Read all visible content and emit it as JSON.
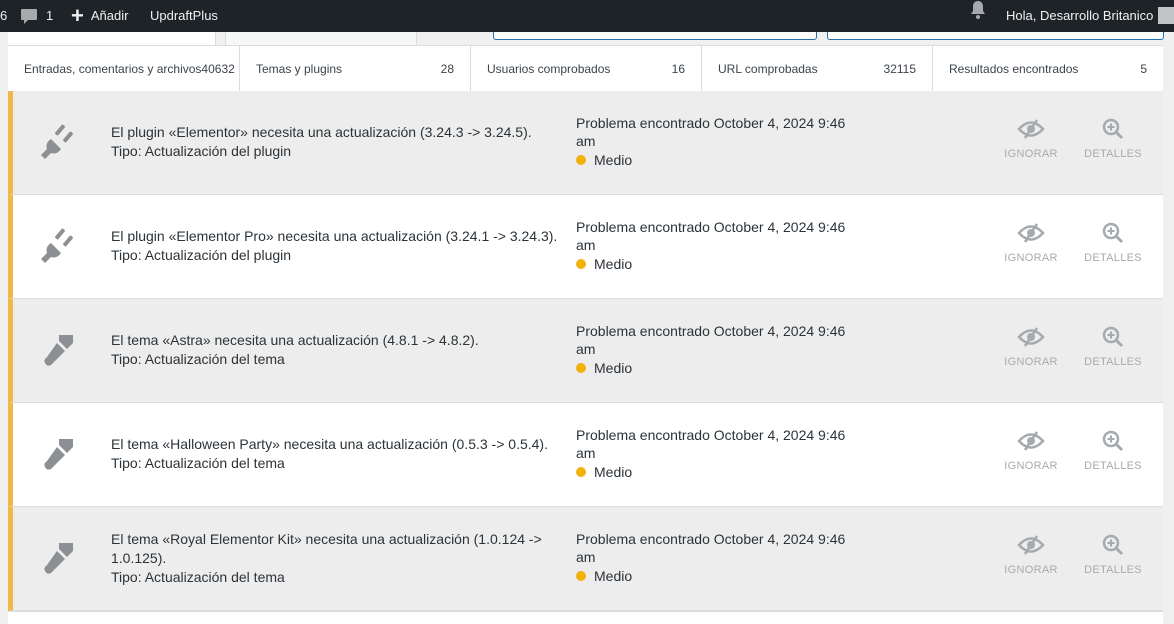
{
  "admin_bar": {
    "updates_count": "6",
    "comments_count": "1",
    "new_label": "Añadir",
    "updraft_label": "UpdraftPlus",
    "greeting": "Hola, Desarrollo Britanico"
  },
  "stats": [
    {
      "label": "Entradas, comentarios y archivos",
      "value": "40632"
    },
    {
      "label": "Temas y plugins",
      "value": "28"
    },
    {
      "label": "Usuarios comprobados",
      "value": "16"
    },
    {
      "label": "URL comprobadas",
      "value": "32115"
    },
    {
      "label": "Resultados encontrados",
      "value": "5"
    }
  ],
  "issues": [
    {
      "kind": "plugin",
      "line1": "El plugin «Elementor» necesita una actualización (3.24.3 -> 3.24.5).",
      "line2": "Tipo: Actualización del plugin",
      "found": "Problema encontrado October 4, 2024 9:46 am",
      "severity": "Medio"
    },
    {
      "kind": "plugin",
      "line1": "El plugin «Elementor Pro» necesita una actualización (3.24.1 -> 3.24.3).",
      "line2": "Tipo: Actualización del plugin",
      "found": "Problema encontrado October 4, 2024 9:46 am",
      "severity": "Medio"
    },
    {
      "kind": "theme",
      "line1": "El tema «Astra» necesita una actualización (4.8.1 -> 4.8.2).",
      "line2": "Tipo: Actualización del tema",
      "found": "Problema encontrado October 4, 2024 9:46 am",
      "severity": "Medio"
    },
    {
      "kind": "theme",
      "line1": "El tema «Halloween Party» necesita una actualización (0.5.3 -> 0.5.4).",
      "line2": "Tipo: Actualización del tema",
      "found": "Problema encontrado October 4, 2024 9:46 am",
      "severity": "Medio"
    },
    {
      "kind": "theme",
      "line1": "El tema «Royal Elementor Kit» necesita una actualización (1.0.124 -> 1.0.125).",
      "line2": "Tipo: Actualización del tema",
      "found": "Problema encontrado October 4, 2024 9:46 am",
      "severity": "Medio"
    }
  ],
  "actions": {
    "ignore_label": "IGNORAR",
    "details_label": "DETALLES"
  },
  "colors": {
    "severity_medium": "#f0b20b",
    "row_accent": "#f0b849",
    "admin_bar": "#1d2327"
  },
  "icons": {
    "plugin": "plug-icon",
    "theme": "paintbrush-icon",
    "ignore": "eye-slash-icon",
    "details": "zoom-in-icon"
  }
}
